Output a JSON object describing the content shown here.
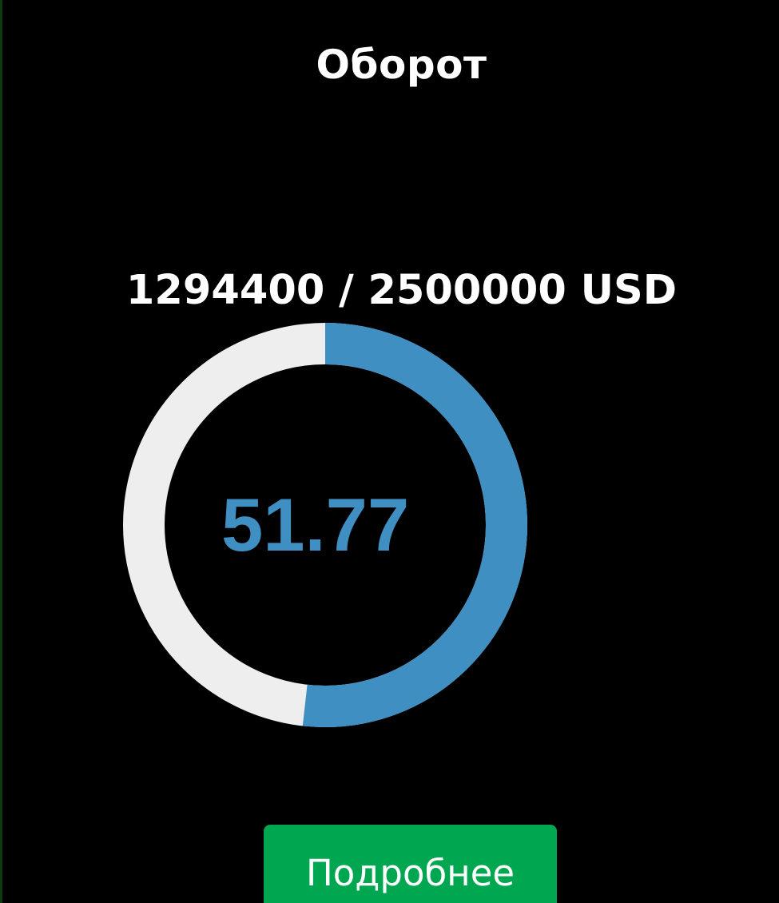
{
  "title": "Оборот",
  "turnover": {
    "amount_text": "1294400 / 2500000 USD",
    "current": 1294400,
    "target": 2500000,
    "currency": "USD",
    "percent_text": "51.77",
    "progress_fraction": 0.5177
  },
  "colors": {
    "background": "#000000",
    "progress": "#3f8fc2",
    "track": "#eeeeee",
    "button": "#00a650",
    "text": "#ffffff"
  },
  "buttons": {
    "details_label": "Подробнее"
  }
}
